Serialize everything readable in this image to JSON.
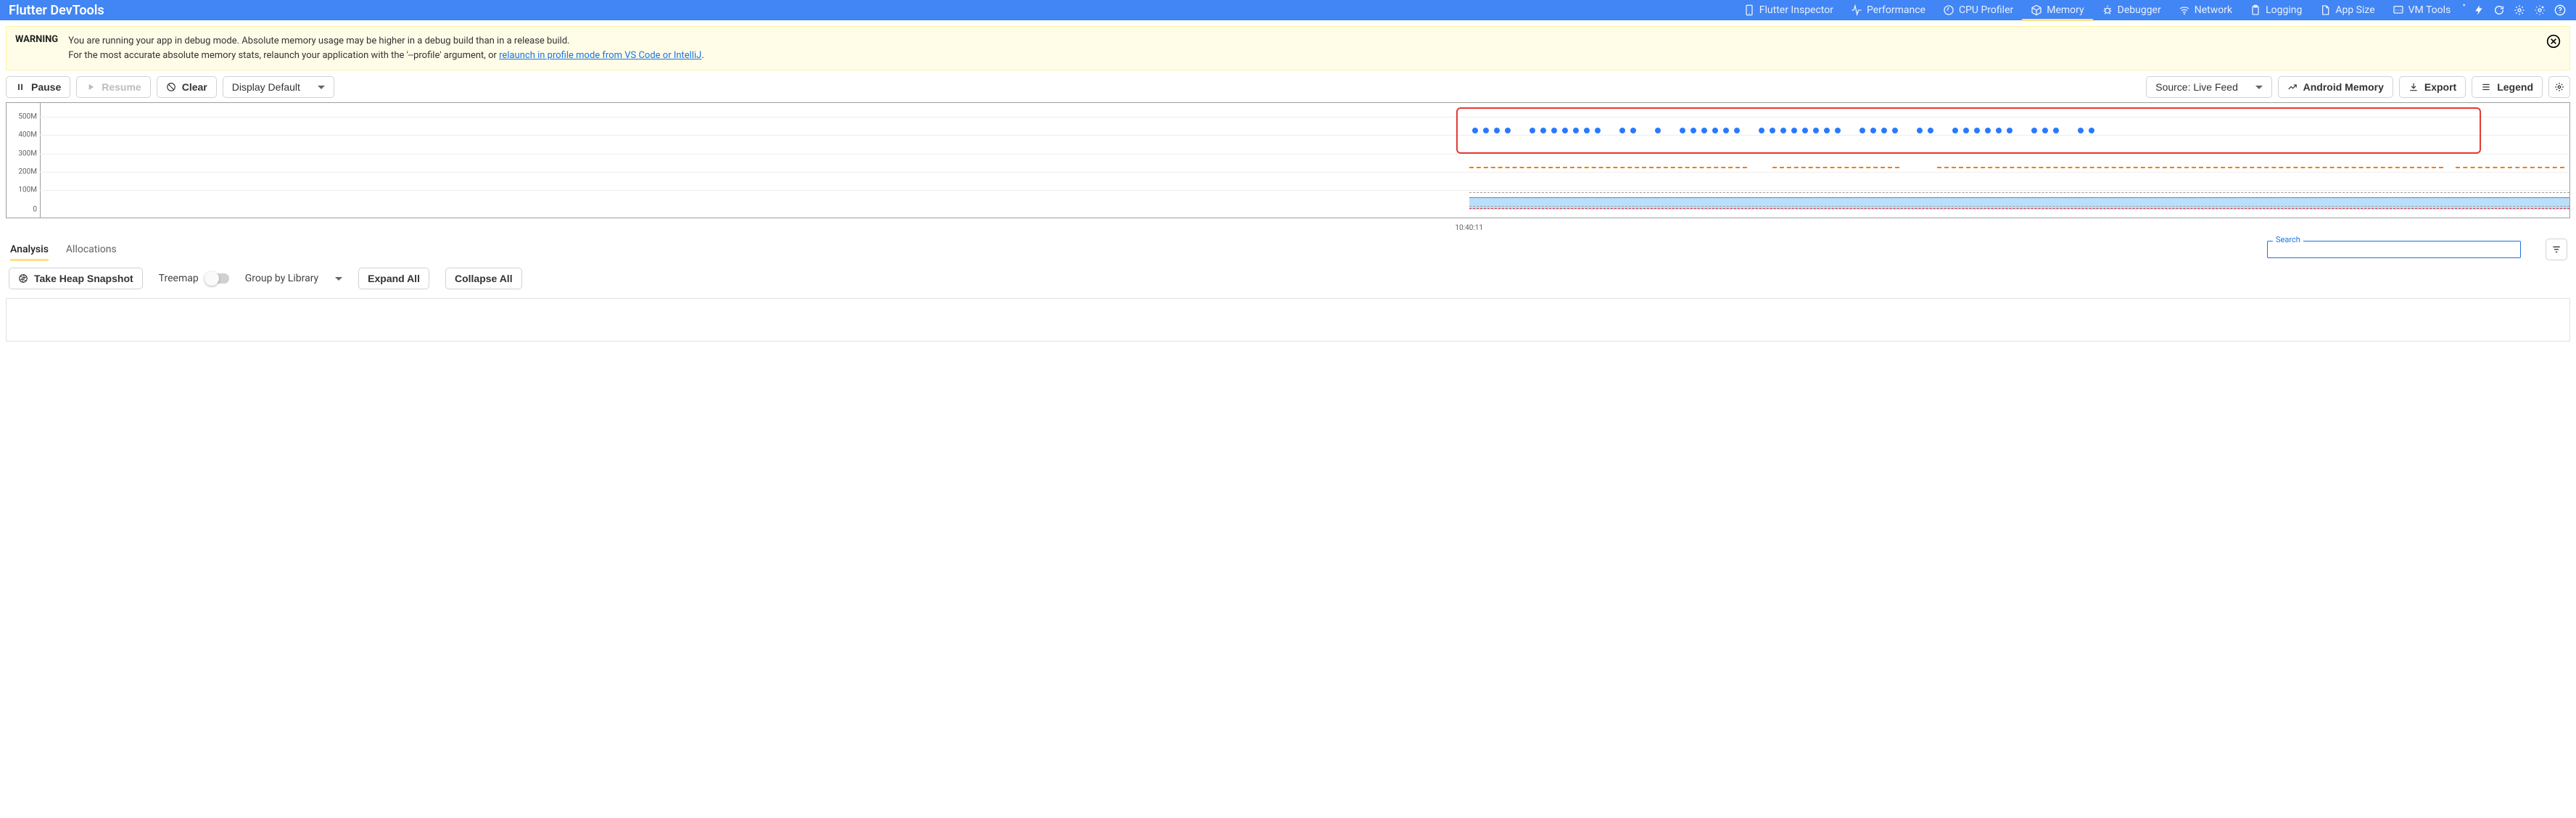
{
  "app": {
    "title": "Flutter DevTools"
  },
  "tabs": [
    {
      "icon": "phone-icon",
      "label": "Flutter Inspector"
    },
    {
      "icon": "pulse-icon",
      "label": "Performance"
    },
    {
      "icon": "gauge-icon",
      "label": "CPU Profiler"
    },
    {
      "icon": "package-icon",
      "label": "Memory",
      "active": true
    },
    {
      "icon": "bug-icon",
      "label": "Debugger"
    },
    {
      "icon": "wifi-icon",
      "label": "Network"
    },
    {
      "icon": "clipboard-icon",
      "label": "Logging"
    },
    {
      "icon": "file-icon",
      "label": "App Size"
    },
    {
      "icon": "vm-icon",
      "label": "VM Tools"
    }
  ],
  "banner": {
    "title": "WARNING",
    "line1": "You are running your app in debug mode. Absolute memory usage may be higher in a debug build than in a release build.",
    "line2_prefix": "For the most accurate absolute memory stats, relaunch your application with the '--profile' argument, or ",
    "link": "relaunch in profile mode from VS Code or IntelliJ",
    "line2_suffix": "."
  },
  "toolbar": {
    "pause": "Pause",
    "resume": "Resume",
    "clear": "Clear",
    "display": "Display Default",
    "source": "Source: Live Feed",
    "android": "Android Memory",
    "export": "Export",
    "legend": "Legend"
  },
  "chart_data": {
    "type": "line",
    "ylabel": "",
    "xlabel": "",
    "ytick_labels": [
      "500M",
      "400M",
      "300M",
      "200M",
      "100M",
      "0"
    ],
    "ytick_values": [
      500,
      400,
      300,
      200,
      100,
      0
    ],
    "ylim": [
      0,
      530
    ],
    "x_tick_label": "10:40:11",
    "series": [
      {
        "name": "events",
        "style": "blue-dots",
        "approx_value": 500,
        "highlighted": true
      },
      {
        "name": "orange-dashed",
        "style": "orange-dashed",
        "approx_value": 230
      },
      {
        "name": "gray-dashed-upper",
        "style": "gray-dashed",
        "approx_value": 115
      },
      {
        "name": "heap-used-area",
        "style": "blue-area",
        "approx_value": 95
      },
      {
        "name": "gray-dashed-lower",
        "style": "gray-dashed",
        "approx_value": 60
      },
      {
        "name": "red-dashed",
        "style": "red-dashed",
        "approx_value": 40
      }
    ],
    "data_start_fraction": 0.565
  },
  "subtabs": {
    "analysis": "Analysis",
    "allocations": "Allocations"
  },
  "search": {
    "label": "Search",
    "value": ""
  },
  "analysis": {
    "snapshot": "Take Heap Snapshot",
    "treemap": "Treemap",
    "groupby": "Group by Library",
    "expand": "Expand All",
    "collapse": "Collapse All"
  }
}
